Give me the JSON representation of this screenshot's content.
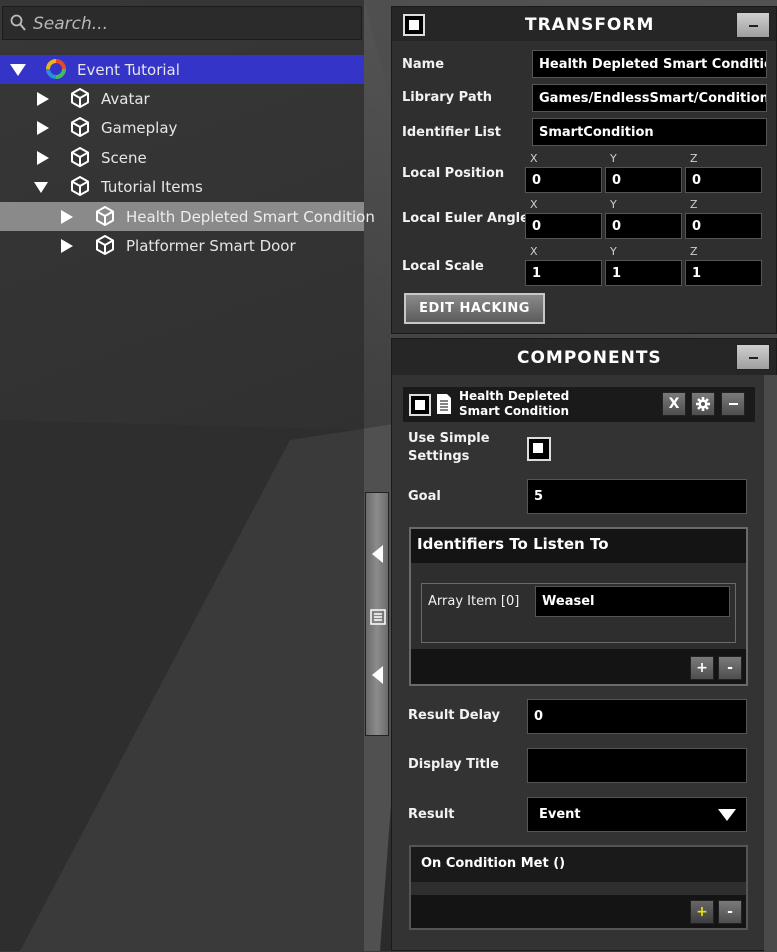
{
  "colors": {
    "selection": "#3434c8",
    "panel": "#2f2f2f",
    "field": "#000000",
    "plus_accent": "#d4d400"
  },
  "hierarchy": {
    "search_placeholder": "Search...",
    "items": [
      {
        "label": "Event Tutorial",
        "icon": "scene-logo-icon",
        "expanded": true,
        "selected": true
      },
      {
        "label": "Avatar",
        "icon": "cube-icon",
        "expanded": false
      },
      {
        "label": "Gameplay",
        "icon": "cube-icon",
        "expanded": false
      },
      {
        "label": "Scene",
        "icon": "cube-icon",
        "expanded": false
      },
      {
        "label": "Tutorial Items",
        "icon": "cube-icon",
        "expanded": true
      },
      {
        "label": "Health Depleted Smart Condition",
        "icon": "cube-icon",
        "expanded": false,
        "highlighted": true
      },
      {
        "label": "Platformer Smart Door",
        "icon": "cube-icon",
        "expanded": false
      }
    ]
  },
  "transform": {
    "title": "TRANSFORM",
    "name_label": "Name",
    "name_value": "Health Depleted Smart Condition",
    "path_label": "Library Path",
    "path_value": "Games/EndlessSmart/Conditions",
    "ident_label": "Identifier List",
    "ident_value": "SmartCondition",
    "axes": [
      "X",
      "Y",
      "Z"
    ],
    "position_label": "Local Position",
    "position": [
      "0",
      "0",
      "0"
    ],
    "euler_label": "Local Euler Angles",
    "euler": [
      "0",
      "0",
      "0"
    ],
    "scale_label": "Local Scale",
    "scale": [
      "1",
      "1",
      "1"
    ],
    "edit_button": "EDIT HACKING"
  },
  "components": {
    "title": "COMPONENTS",
    "component_name": "Health Depleted Smart Condition",
    "close_label": "X",
    "simple_label": "Use Simple Settings",
    "goal_label": "Goal",
    "goal_value": "5",
    "identifiers_title": "Identifiers To Listen To",
    "array_label": "Array Item [0]",
    "array_value": "Weasel",
    "delay_label": "Result Delay",
    "delay_value": "0",
    "display_title_label": "Display Title",
    "display_title_value": "",
    "result_label": "Result",
    "result_value": "Event",
    "event_title": "On Condition Met ()",
    "plus": "+",
    "minus": "-"
  }
}
